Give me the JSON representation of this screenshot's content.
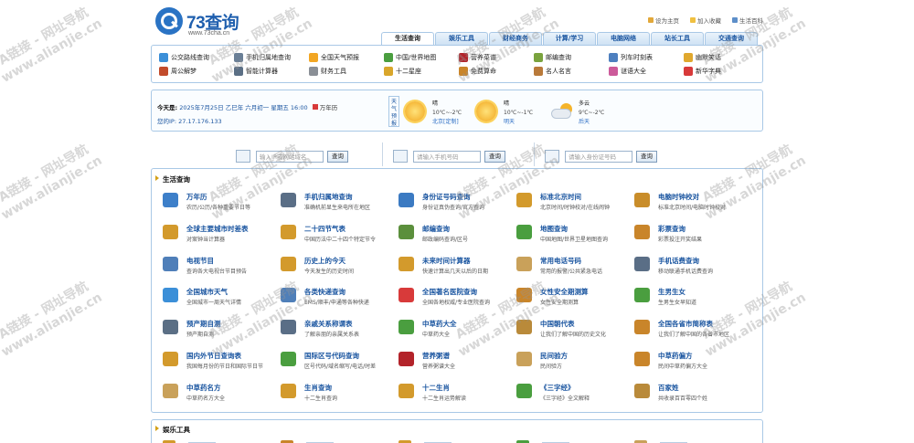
{
  "header": {
    "logo_text": "73查询",
    "logo_url": "www.73cha.cn",
    "links": [
      "设为主页",
      "加入收藏",
      "生活百科"
    ]
  },
  "tabs": [
    "生活查询",
    "娱乐工具",
    "财经商务",
    "计算/学习",
    "电脑网络",
    "站长工具",
    "交通查询"
  ],
  "active_tab": "生活查询",
  "quick_links": [
    {
      "label": "公交路线查询",
      "color": "#3b8fd8"
    },
    {
      "label": "手机归属地查询",
      "color": "#6a7f96"
    },
    {
      "label": "全国天气预报",
      "color": "#f2a623"
    },
    {
      "label": "中国/世界地图",
      "color": "#4a9e3f"
    },
    {
      "label": "营养菜谱",
      "color": "#b3232a"
    },
    {
      "label": "邮编查询",
      "color": "#7aa33e"
    },
    {
      "label": "列车时刻表",
      "color": "#4d7fbf"
    },
    {
      "label": "幽默笑话",
      "color": "#e0a82e"
    },
    {
      "label": "周公解梦",
      "color": "#c24b2b"
    },
    {
      "label": "智能计算器",
      "color": "#5b6f85"
    },
    {
      "label": "财务工具",
      "color": "#8a8f96"
    },
    {
      "label": "十二星座",
      "color": "#d9a62b"
    },
    {
      "label": "免费算命",
      "color": "#c9852a"
    },
    {
      "label": "名人名言",
      "color": "#b97a3a"
    },
    {
      "label": "谜语大全",
      "color": "#cc5a9a"
    },
    {
      "label": "新华字典",
      "color": "#d83a3a"
    }
  ],
  "info": {
    "date_label": "今天是:",
    "date_value": "2025年7月25日  乙巳年 六月初一  星期五  16:00",
    "calendar_link": "万年历",
    "ip_label": "您的IP:",
    "ip_value": "27.17.176.133",
    "weather_label": "天气预报",
    "weather": [
      {
        "cond": "晴",
        "temp": "10℃~-2℃",
        "day": "北京",
        "extra": "[定制]",
        "icon": "sun"
      },
      {
        "cond": "晴",
        "temp": "10℃~-1℃",
        "day": "明天",
        "extra": "",
        "icon": "sun"
      },
      {
        "cond": "多云",
        "temp": "9℃~-2℃",
        "day": "后天",
        "extra": "",
        "icon": "cloud-sun"
      }
    ]
  },
  "search": [
    {
      "placeholder": "输入IP或网站域名",
      "button": "查询"
    },
    {
      "placeholder": "请输入手机号码",
      "button": "查询"
    },
    {
      "placeholder": "请输入身份证号码",
      "button": "查询"
    }
  ],
  "section_title": "生活查询",
  "services": [
    {
      "title": "万年历",
      "desc": "农历/公历/各种重要节日等",
      "color": "#3d7fc9"
    },
    {
      "title": "手机归属地查询",
      "desc": "准确机前显生来电所在地区",
      "color": "#5a6e86"
    },
    {
      "title": "身份证号码查询",
      "desc": "身份证真伪查询/官方查询",
      "color": "#3b7ac2"
    },
    {
      "title": "标准北京时间",
      "desc": "北京时间/时钟校对/在线闹钟",
      "color": "#d39a2c"
    },
    {
      "title": "电脑时钟校对",
      "desc": "标准北京时间/电脑时钟校对",
      "color": "#c98d2a"
    },
    {
      "title": "全球主要城市时差表",
      "desc": "对案钟当计算器",
      "color": "#d39a2c"
    },
    {
      "title": "二十四节气表",
      "desc": "中国历法中二十四个特定节令",
      "color": "#d39a2c"
    },
    {
      "title": "邮编查询",
      "desc": "邮政编码查询/区号",
      "color": "#5b8f3c"
    },
    {
      "title": "地图查询",
      "desc": "中国地图/世界卫星地图查询",
      "color": "#4a9e3f"
    },
    {
      "title": "彩票查询",
      "desc": "彩票投注开奖结果",
      "color": "#c9852a"
    },
    {
      "title": "电视节目",
      "desc": "查询各大电视台节目预告",
      "color": "#4f7fb9"
    },
    {
      "title": "历史上的今天",
      "desc": "今天发生的历史时间",
      "color": "#d39a2c"
    },
    {
      "title": "未来时间计算器",
      "desc": "快速计算出几天以后的日期",
      "color": "#d39a2c"
    },
    {
      "title": "常用电话号码",
      "desc": "常用的报警/公共紧急电话",
      "color": "#c9a15a"
    },
    {
      "title": "手机话费查询",
      "desc": "移动联通手机话费查询",
      "color": "#5a6e86"
    },
    {
      "title": "全国城市天气",
      "desc": "全国城市一周天气详情",
      "color": "#3b8fd8"
    },
    {
      "title": "各类快递查询",
      "desc": "EMS/顺丰/申通等各种快递",
      "color": "#4f7fb9"
    },
    {
      "title": "全国著名医院查询",
      "desc": "全国各地权威/专业医院查询",
      "color": "#d83a3a"
    },
    {
      "title": "女性安全期测算",
      "desc": "女性安全期测算",
      "color": "#c9852a"
    },
    {
      "title": "生男生女",
      "desc": "生男生女早知道",
      "color": "#4a9e3f"
    },
    {
      "title": "预产期自测",
      "desc": "预产期自测",
      "color": "#5b6f85"
    },
    {
      "title": "亲戚关系称谓表",
      "desc": "了解亲朋的亲属关系表",
      "color": "#5a6e86"
    },
    {
      "title": "中草药大全",
      "desc": "中草药大全",
      "color": "#4a9e3f"
    },
    {
      "title": "中国朝代表",
      "desc": "让我们了解中国的历史文化",
      "color": "#b98a3a"
    },
    {
      "title": "全国各省市简称表",
      "desc": "让我们了解中国的各省市地区",
      "color": "#c9852a"
    },
    {
      "title": "国内外节日查询表",
      "desc": "我国每月份的节日和国际节日节",
      "color": "#d39a2c"
    },
    {
      "title": "国际区号代码查询",
      "desc": "区号代码/域名缩写/电话/时差",
      "color": "#4a9e3f"
    },
    {
      "title": "营养粥谱",
      "desc": "营养粥谱大全",
      "color": "#b3232a"
    },
    {
      "title": "民间验方",
      "desc": "民间验方",
      "color": "#c9a15a"
    },
    {
      "title": "中草药偏方",
      "desc": "民间中草药偏方大全",
      "color": "#c9852a"
    },
    {
      "title": "中草药名方",
      "desc": "中草药名方大全",
      "color": "#c9a15a"
    },
    {
      "title": "生肖查询",
      "desc": "十二生肖查询",
      "color": "#d39a2c"
    },
    {
      "title": "十二生肖",
      "desc": "十二生肖运势解读",
      "color": "#d39a2c"
    },
    {
      "title": "《三字经》",
      "desc": "《三字经》全文解释",
      "color": "#4a9e3f"
    },
    {
      "title": "百家姓",
      "desc": "共收录百百零四个姓",
      "color": "#b98a3a"
    }
  ],
  "section2_title": "娱乐工具",
  "watermark": {
    "line1": "A链接 - 网址导航",
    "line2": "www.alianjie.cn"
  }
}
